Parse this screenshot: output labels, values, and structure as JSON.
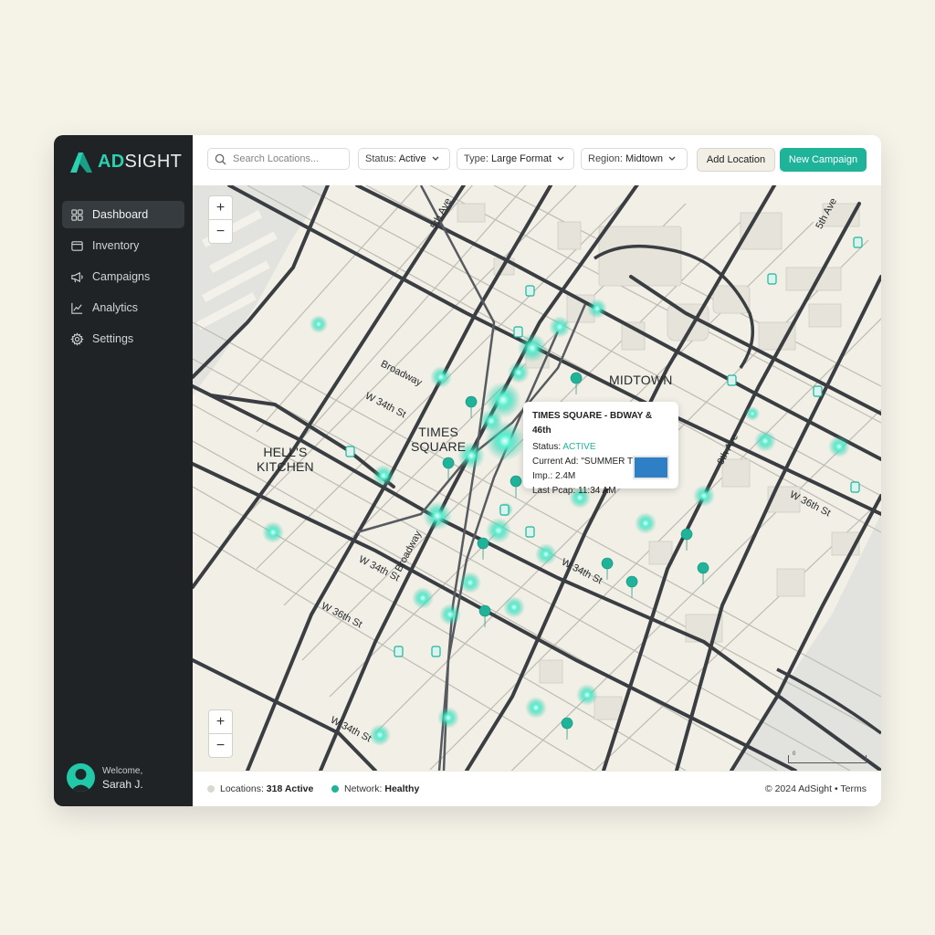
{
  "brand": {
    "name_a": "AD",
    "name_b": "SIGHT",
    "accent": "#2ad1b0"
  },
  "sidebar": {
    "items": [
      {
        "label": "Dashboard",
        "icon": "dashboard-icon",
        "active": true
      },
      {
        "label": "Inventory",
        "icon": "inventory-icon"
      },
      {
        "label": "Campaigns",
        "icon": "megaphone-icon"
      },
      {
        "label": "Analytics",
        "icon": "chart-line-icon"
      },
      {
        "label": "Settings",
        "icon": "gear-icon"
      }
    ],
    "user": {
      "greeting": "Welcome,",
      "name": "Sarah J."
    }
  },
  "toolbar": {
    "search_placeholder": "Search Locations...",
    "filters": [
      {
        "label": "Status:",
        "value": "Active"
      },
      {
        "label": "Type:",
        "value": "Large Format"
      },
      {
        "label": "Region:",
        "value": "Midtown"
      }
    ],
    "add_label": "Add Location",
    "new_label": "New Campaign"
  },
  "map": {
    "zoom_in": "+",
    "zoom_out": "−",
    "areas": {
      "hells": "HELL'S",
      "kitchen": "KITCHEN",
      "times": "TIMES",
      "square": "SQUARE",
      "midtown": "MIDTOWN"
    },
    "streets": [
      "5th Ave",
      "5th Ave",
      "Broadway",
      "W 34th St",
      "9th Ave",
      "W 36th St",
      "Broadway",
      "W 34th St",
      "W 34th St",
      "W 36th St",
      "W 34th St"
    ],
    "scale_label": "0",
    "popup": {
      "title": "TIMES SQUARE - BDWAY & 46th",
      "status_label": "Status:",
      "status_value": "ACTIVE",
      "ad_label": "Current Ad:",
      "ad_value": "\"SUMMER TECH\"",
      "imp_label": "Imp.:",
      "imp_value": "2.4M",
      "last_label": "Last Pcap:",
      "last_value": "11:34 AM"
    }
  },
  "footer": {
    "locations_label": "Locations:",
    "locations_value": "318 Active",
    "network_label": "Network:",
    "network_value": "Healthy",
    "copyright": "© 2024 AdSight",
    "separator": "•",
    "terms": "Terms"
  }
}
